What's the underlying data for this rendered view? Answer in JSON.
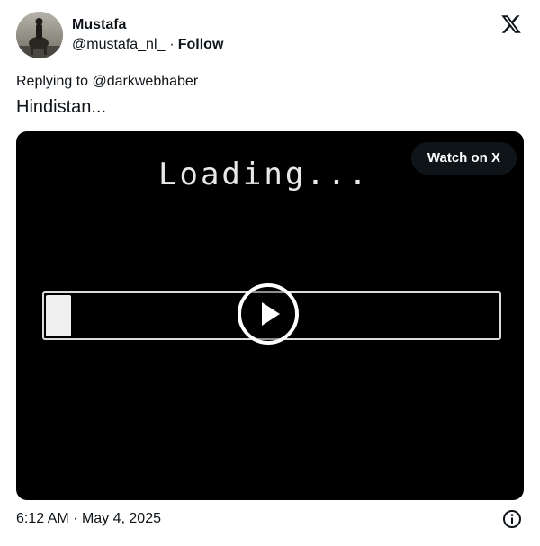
{
  "author": {
    "name": "Mustafa",
    "handle": "@mustafa_nl_",
    "separator": "·",
    "follow_label": "Follow"
  },
  "icons": {
    "platform": "x-logo-icon",
    "info": "info-icon",
    "play": "play-icon"
  },
  "reply": {
    "prefix": "Replying to",
    "mention": "@darkwebhaber"
  },
  "tweet": {
    "text": "Hindistan..."
  },
  "media": {
    "video_text": "Loading...",
    "progress": 0.055,
    "watch_label": "Watch on X"
  },
  "footer": {
    "time": "6:12 AM",
    "separator": "·",
    "date": "May 4, 2025"
  },
  "colors": {
    "text": "#0f1419",
    "media_bg": "#000000",
    "button_bg": "#0f1419"
  }
}
